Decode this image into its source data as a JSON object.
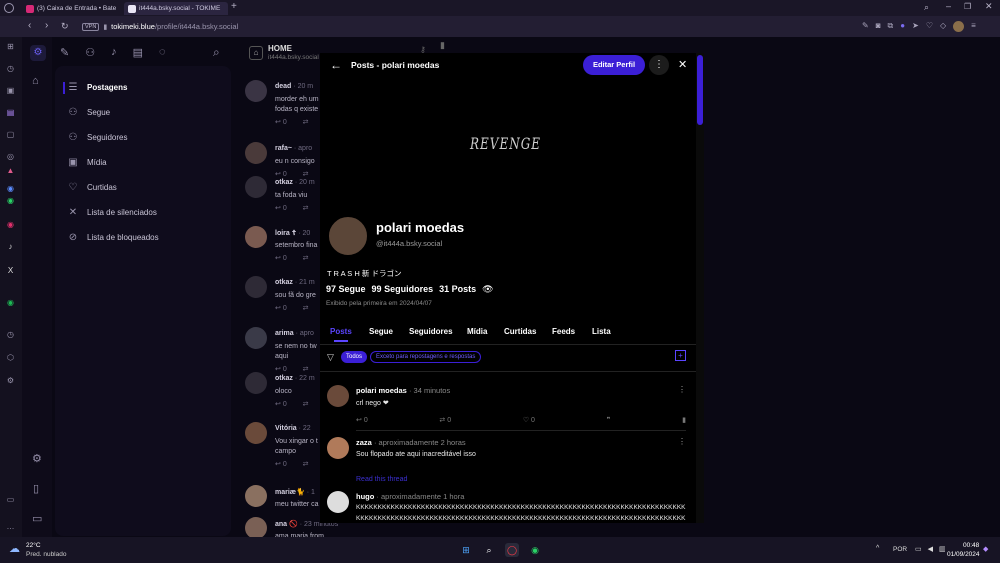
{
  "browser": {
    "tabs": [
      {
        "title": "(3) Caixa de Entrada • Bate",
        "active": false
      },
      {
        "title": "it444a.bsky.social - TOKIME",
        "active": true
      }
    ],
    "add_tab": "+",
    "url_host": "tokimeki.blue",
    "url_path": "/profile/it444a.bsky.social",
    "vpn_label": "VPN"
  },
  "app": {
    "home_title": "HOME",
    "home_sub": "it444a.bsky.social",
    "menu": [
      {
        "label": "Postagens",
        "icon": "☰"
      },
      {
        "label": "Segue",
        "icon": "⚇"
      },
      {
        "label": "Seguidores",
        "icon": "⚇"
      },
      {
        "label": "Mídia",
        "icon": "▣"
      },
      {
        "label": "Curtidas",
        "icon": "♡"
      },
      {
        "label": "Lista de silenciados",
        "icon": "✕"
      },
      {
        "label": "Lista de bloqueados",
        "icon": "⊘"
      }
    ],
    "feed": [
      {
        "name": "dead",
        "time": "· 20 m",
        "lines": [
          "morder eh um",
          "fodas q existe"
        ]
      },
      {
        "name": "rafa~",
        "time": "· apro",
        "lines": [
          "eu n consigo"
        ]
      },
      {
        "name": "otkaz",
        "time": "· 20 m",
        "lines": [
          "ta foda viu"
        ]
      },
      {
        "name": "loira ☦",
        "time": "· 20",
        "lines": [
          "setembro fina"
        ]
      },
      {
        "name": "otkaz",
        "time": "· 21 m",
        "lines": [
          "sou fã do gre"
        ]
      },
      {
        "name": "arima",
        "time": "· apro",
        "lines": [
          "se nem no tw",
          "aqui"
        ]
      },
      {
        "name": "otkaz",
        "time": "· 22 m",
        "lines": [
          "oloco"
        ]
      },
      {
        "name": "Vitória",
        "time": "· 22",
        "lines": [
          "Vou xingar o t",
          "campo"
        ]
      },
      {
        "name": "mariæ🐈",
        "time": "· 1",
        "lines": [
          "meu twitter ca"
        ]
      },
      {
        "name": "ana 🚫",
        "time": "· 23 minutos",
        "lines": [
          "ama maria from tulsa"
        ]
      }
    ],
    "feed_counts": [
      "0",
      "0",
      "0",
      "0",
      "0",
      "0",
      "0",
      "0"
    ]
  },
  "modal": {
    "title": "Posts - polari moedas",
    "edit_button": "Editar Perfil",
    "banner_text": "REVENGE",
    "display_name": "polari moedas",
    "handle": "@it444a.bsky.social",
    "bio": "T R A S H 新 ドラゴン",
    "follows_count": "97",
    "follows_label": "Segue",
    "followers_count": "99",
    "followers_label": "Seguidores",
    "posts_count": "31",
    "posts_label": "Posts",
    "first_seen": "Exibido pela primeira em 2024/04/07",
    "tabs": [
      "Posts",
      "Segue",
      "Seguidores",
      "Mídia",
      "Curtidas",
      "Feeds",
      "Lista"
    ],
    "filter_all": "Todos",
    "filter_exclude": "Exceto para repostagens e respostas",
    "posts": [
      {
        "name": "polari moedas",
        "time": "· 34 minutos",
        "text": "crl nego ❤",
        "reply": "0",
        "repost": "0",
        "like": "0"
      },
      {
        "name": "zaza",
        "time": "· aproximadamente 2 horas",
        "text": "Sou flopado ate aqui inacreditável isso",
        "read_thread": "Read this thread"
      },
      {
        "name": "hugo",
        "time": "· aproximadamente 1 hora",
        "text": "KKKKKKKKKKKKKKKKKKKKKKKKKKKKKKKKKKKKKKKKKKKKKKKKKKKKKKKKKKKKKKKKKKKKKKKKKKKKK",
        "text2": "KKKKKKKKKKKKKKKKKKKKKKKKKKKKKKKKKKKKKKKKKKKKKKKKKKKKKKKKKKKKKKKKKKKKKKKKKKKKKK"
      }
    ]
  },
  "taskbar": {
    "weather_temp": "22°C",
    "weather_desc": "Pred. nublado",
    "lang": "POR",
    "time": "00:48",
    "date": "01/09/2024"
  },
  "colors": {
    "accent": "#3b1fd6",
    "bg": "#0a0814"
  }
}
